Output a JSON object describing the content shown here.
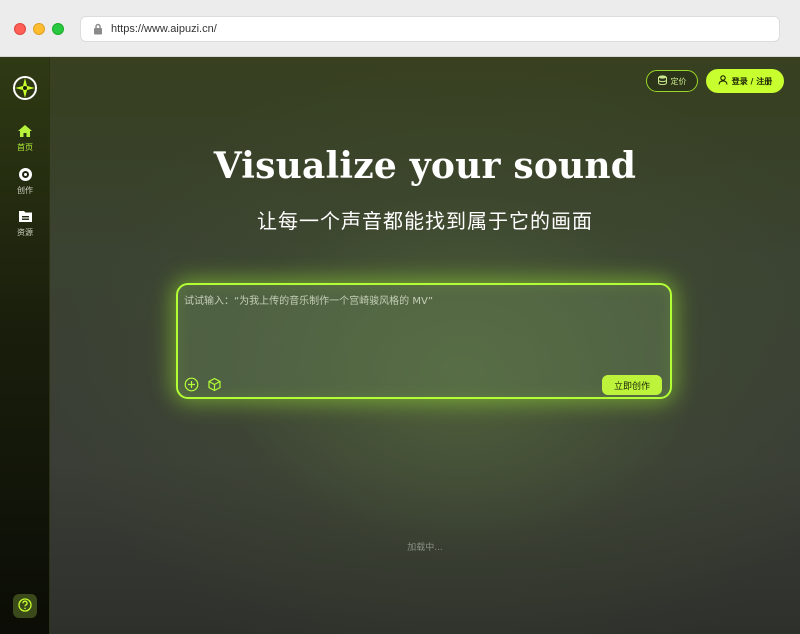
{
  "browser": {
    "url": "https://www.aipuzi.cn/"
  },
  "sidebar": {
    "logo_icon": "compass-star-icon",
    "items": [
      {
        "label": "首页",
        "icon": "home-icon",
        "active": true
      },
      {
        "label": "创作",
        "icon": "disc-icon",
        "active": false
      },
      {
        "label": "资源",
        "icon": "folder-icon",
        "active": false
      }
    ],
    "help_icon": "help-icon"
  },
  "header": {
    "pricing_label": "定价",
    "login_label": "登录 / 注册"
  },
  "hero": {
    "title": "Visualize your sound",
    "subtitle": "让每一个声音都能找到属于它的画面"
  },
  "prompt": {
    "placeholder": "试试输入：“为我上传的音乐制作一个宫崎骏风格的 MV”",
    "create_label": "立即创作",
    "tools": [
      "add-icon",
      "cube-icon"
    ]
  },
  "status": {
    "loading": "加载中..."
  },
  "colors": {
    "accent": "#c8ff2e",
    "accent_border": "#b3ff35"
  }
}
